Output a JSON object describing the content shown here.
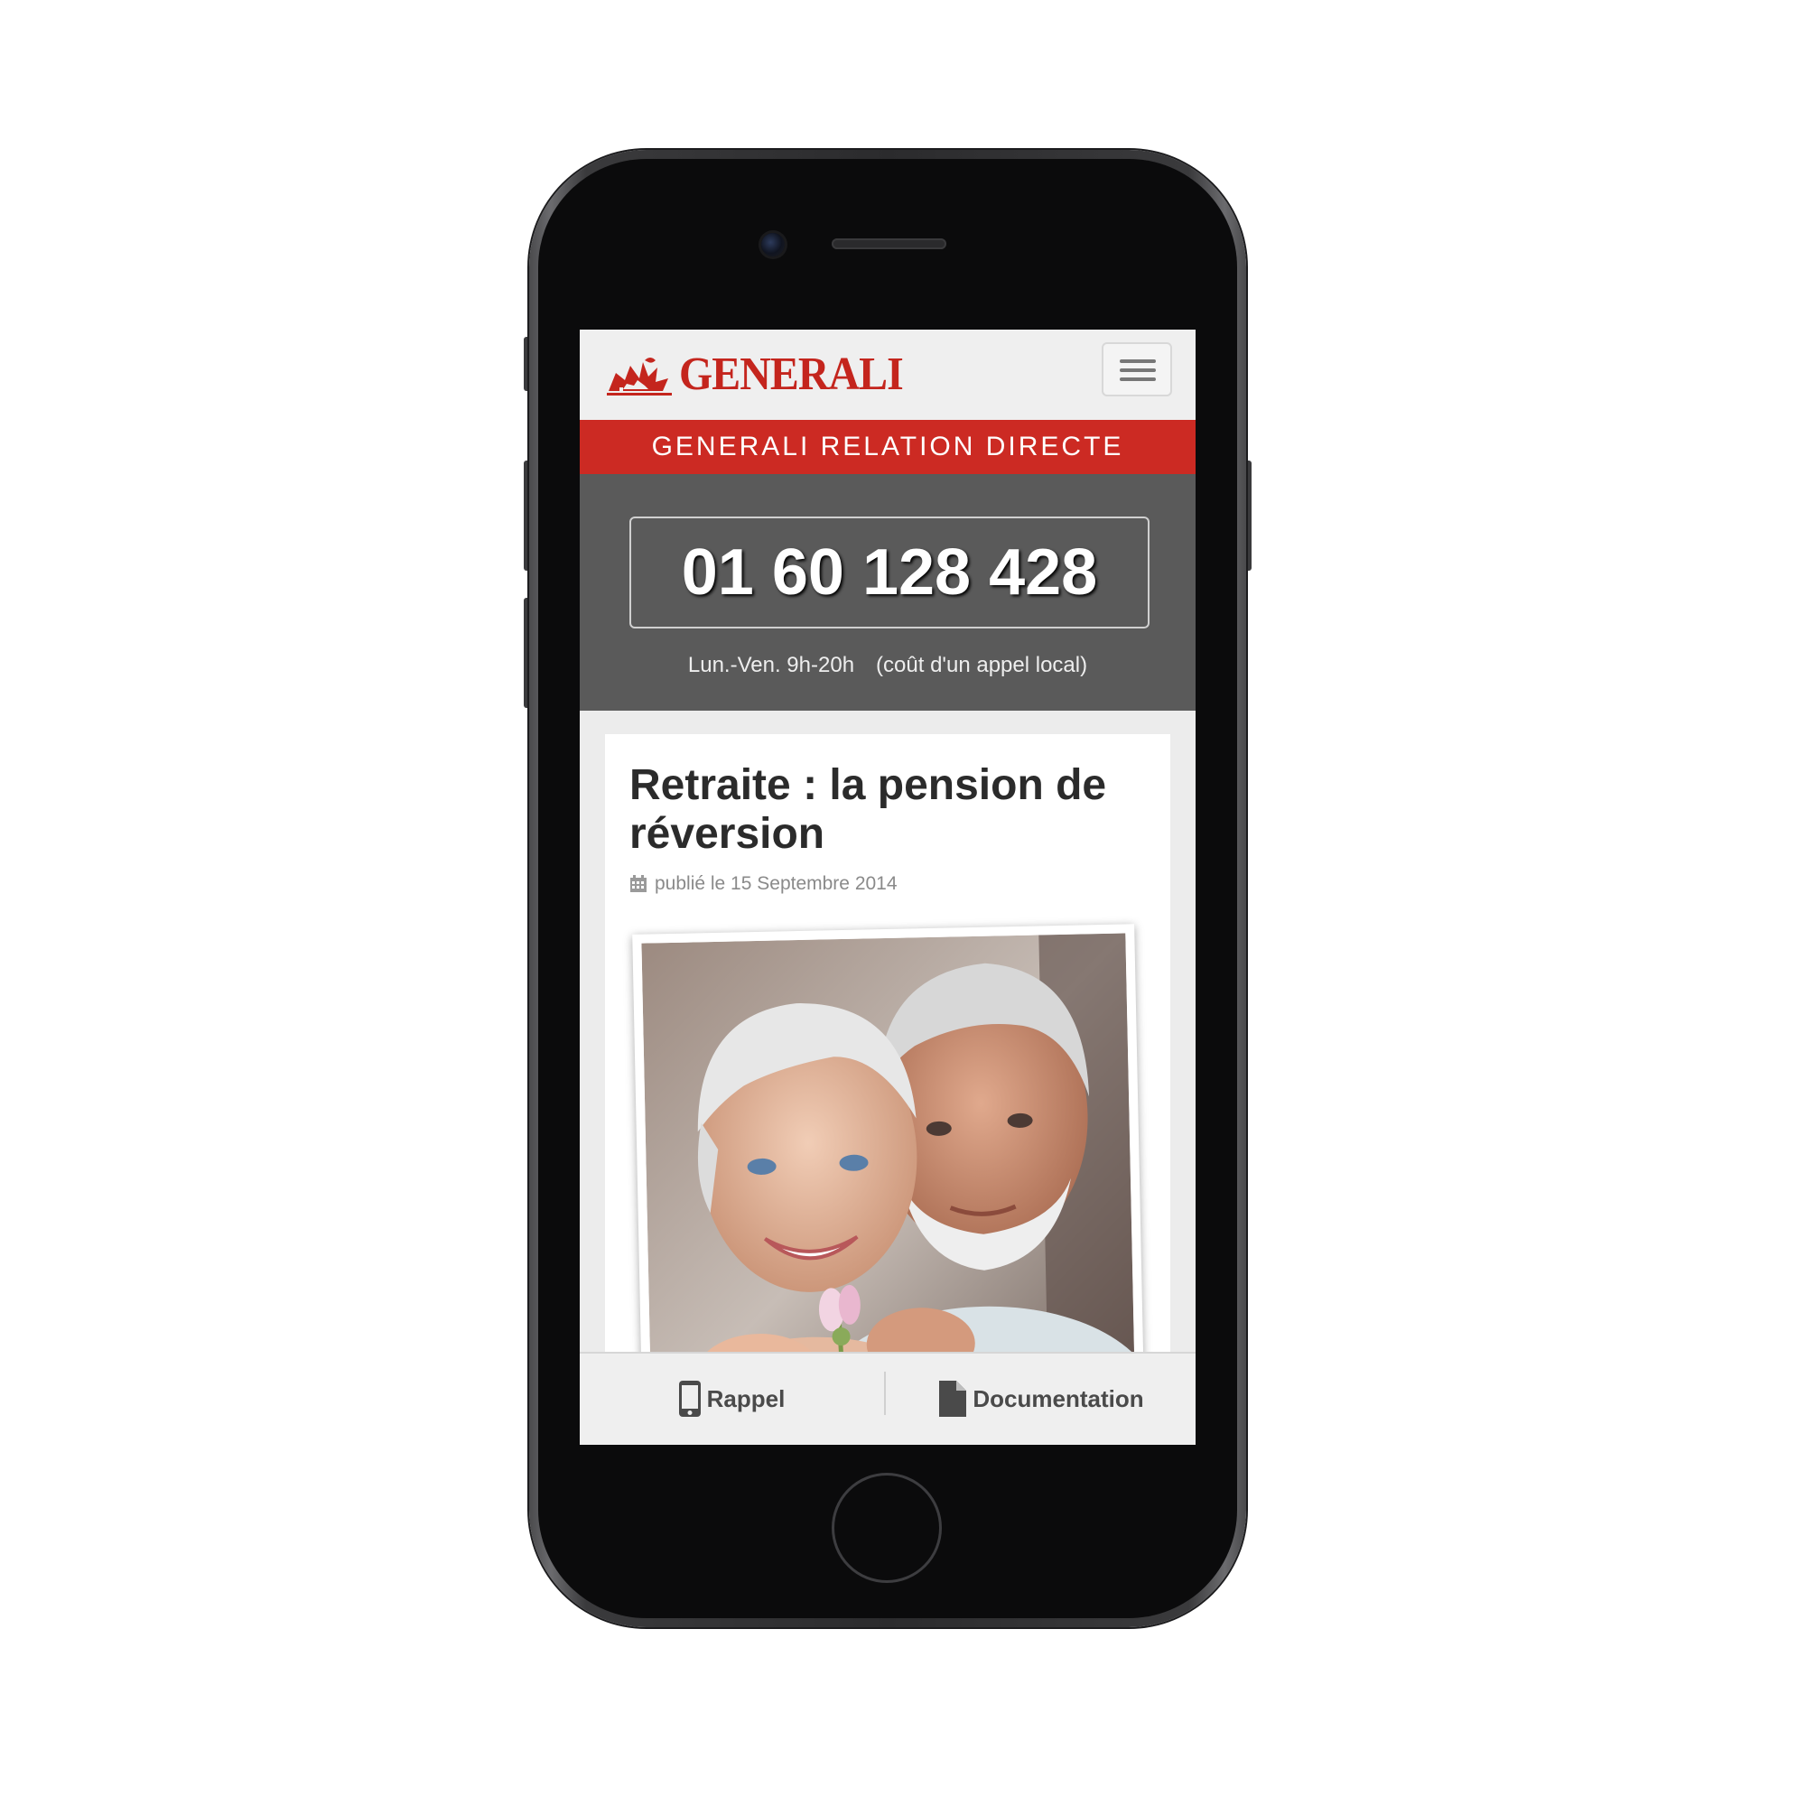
{
  "brand": {
    "name": "GENERALI",
    "color": "#c4251d"
  },
  "header": {
    "menu_icon": "hamburger-icon"
  },
  "banner": {
    "text": "GENERALI RELATION DIRECTE"
  },
  "contact": {
    "phone": "01 60 128 428",
    "hours": "Lun.-Ven. 9h-20h",
    "cost_note": "(coût d'un appel local)"
  },
  "article": {
    "title": "Retraite : la pension de réversion",
    "date_label": "publié le 15 Septembre 2014",
    "date_icon": "calendar-icon"
  },
  "bottom_nav": {
    "rappel_label": "Rappel",
    "rappel_icon": "mobile-phone-icon",
    "documentation_label": "Documentation",
    "documentation_icon": "document-icon"
  }
}
